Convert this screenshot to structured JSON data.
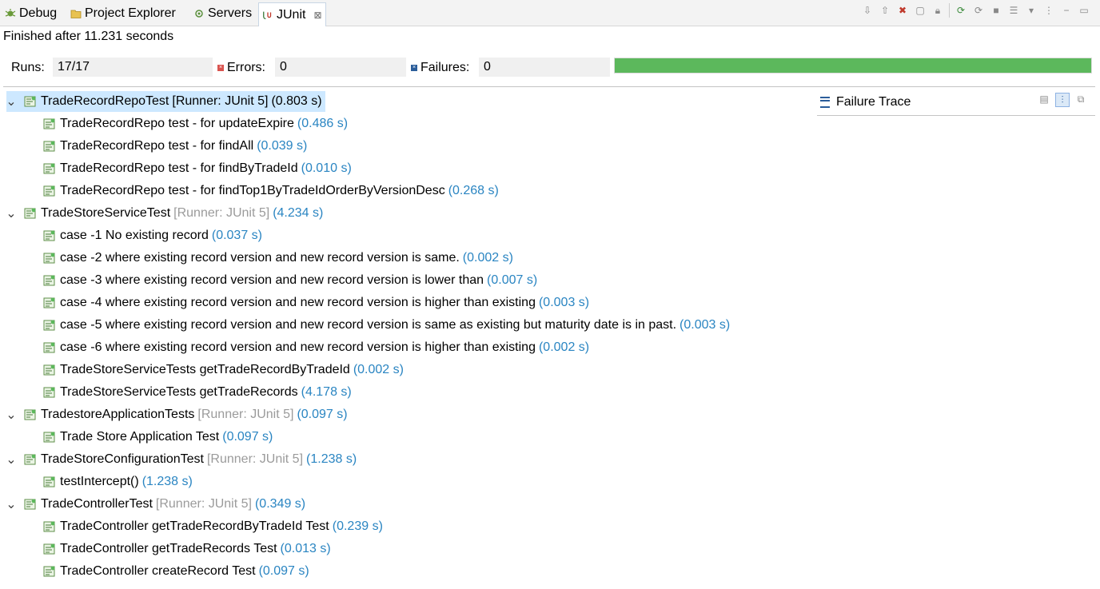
{
  "tabs": [
    {
      "label": "Debug",
      "icon": "debug-icon"
    },
    {
      "label": "Project Explorer",
      "icon": "project-explorer-icon"
    },
    {
      "label": "Servers",
      "icon": "servers-icon"
    },
    {
      "label": "JUnit",
      "icon": "junit-icon",
      "active": true
    }
  ],
  "status": {
    "finished": "Finished after 11.231 seconds"
  },
  "stats": {
    "runs_label": "Runs:",
    "runs_value": "17/17",
    "errors_label": "Errors:",
    "errors_value": "0",
    "failures_label": "Failures:",
    "failures_value": "0",
    "progress": 1.0,
    "progress_color": "#5cb85c"
  },
  "colors": {
    "time": "#2a85c2",
    "runner": "#9b9b9b",
    "selection": "#cde8ff"
  },
  "tree": [
    {
      "suite": "TradeRecordRepoTest",
      "runner": "[Runner: JUnit 5]",
      "time": "(0.803 s)",
      "selected": true,
      "tests": [
        {
          "name": "TradeRecordRepo test - for updateExpire",
          "time": "(0.486 s)"
        },
        {
          "name": "TradeRecordRepo test - for findAll",
          "time": "(0.039 s)"
        },
        {
          "name": "TradeRecordRepo test - for findByTradeId",
          "time": "(0.010 s)"
        },
        {
          "name": "TradeRecordRepo test - for findTop1ByTradeIdOrderByVersionDesc",
          "time": "(0.268 s)"
        }
      ]
    },
    {
      "suite": "TradeStoreServiceTest",
      "runner": "[Runner: JUnit 5]",
      "time": "(4.234 s)",
      "tests": [
        {
          "name": "case -1 No existing record",
          "time": "(0.037 s)"
        },
        {
          "name": "case -2 where existing record version and new record version is same.",
          "time": "(0.002 s)"
        },
        {
          "name": "case -3 where existing record version and new record version is lower than",
          "time": "(0.007 s)"
        },
        {
          "name": "case -4 where existing record version and new record version is higher than existing",
          "time": "(0.003 s)"
        },
        {
          "name": "case -5 where existing record version and new record version is same as existing but maturity date is in past.",
          "time": "(0.003 s)"
        },
        {
          "name": "case -6 where existing record version and new record version is higher than existing",
          "time": "(0.002 s)"
        },
        {
          "name": "TradeStoreServiceTests getTradeRecordByTradeId",
          "time": "(0.002 s)"
        },
        {
          "name": "TradeStoreServiceTests getTradeRecords",
          "time": "(4.178 s)"
        }
      ]
    },
    {
      "suite": "TradestoreApplicationTests",
      "runner": "[Runner: JUnit 5]",
      "time": "(0.097 s)",
      "tests": [
        {
          "name": "Trade Store Application Test",
          "time": "(0.097 s)"
        }
      ]
    },
    {
      "suite": "TradeStoreConfigurationTest",
      "runner": "[Runner: JUnit 5]",
      "time": "(1.238 s)",
      "tests": [
        {
          "name": "testIntercept()",
          "time": "(1.238 s)"
        }
      ]
    },
    {
      "suite": "TradeControllerTest",
      "runner": "[Runner: JUnit 5]",
      "time": "(0.349 s)",
      "tests": [
        {
          "name": "TradeController getTradeRecordByTradeId Test",
          "time": "(0.239 s)"
        },
        {
          "name": "TradeController getTradeRecords Test",
          "time": "(0.013 s)"
        },
        {
          "name": "TradeController createRecord Test",
          "time": "(0.097 s)"
        }
      ]
    }
  ],
  "failure_trace": {
    "title": "Failure Trace"
  }
}
